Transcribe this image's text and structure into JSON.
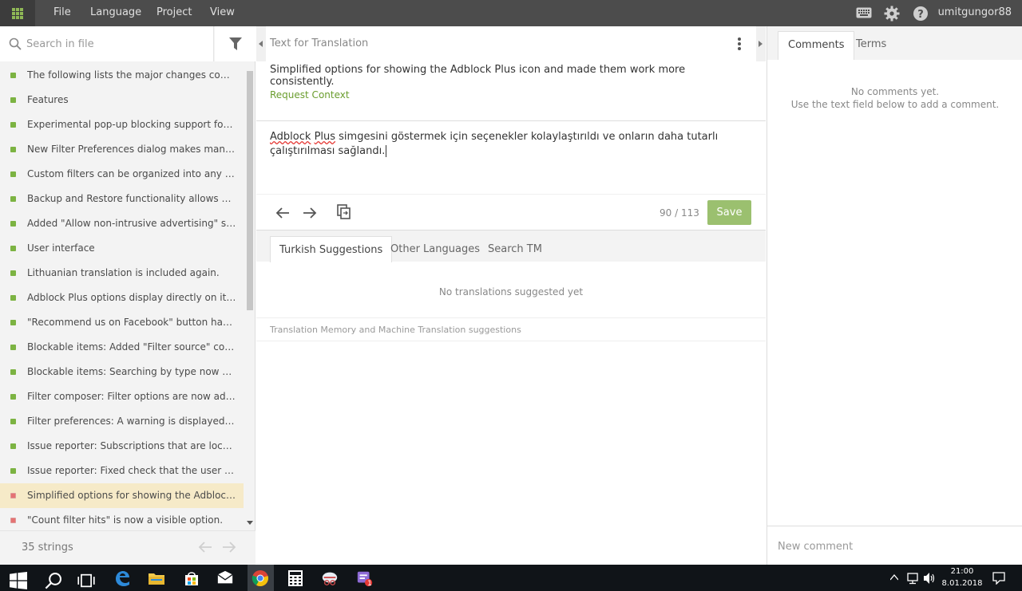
{
  "topbar": {
    "menu": [
      "File",
      "Language",
      "Project",
      "View"
    ],
    "username": "umitgungor88",
    "icons": [
      "keyboard-icon",
      "gear-icon",
      "help-icon"
    ]
  },
  "left": {
    "search_placeholder": "Search in file",
    "strings": [
      {
        "text": "The following lists the major changes compared to the previous version.",
        "status": "translated"
      },
      {
        "text": "Features",
        "status": "translated"
      },
      {
        "text": "Experimental pop-up blocking support for the browser.",
        "status": "translated"
      },
      {
        "text": "New Filter Preferences dialog makes managing filters easier.",
        "status": "translated"
      },
      {
        "text": "Custom filters can be organized into any number of groups.",
        "status": "translated"
      },
      {
        "text": "Backup and Restore functionality allows creating backups.",
        "status": "translated"
      },
      {
        "text": "Added \"Allow non-intrusive advertising\" setting.",
        "status": "translated"
      },
      {
        "text": "User interface",
        "status": "translated"
      },
      {
        "text": "Lithuanian translation is included again.",
        "status": "translated"
      },
      {
        "text": "Adblock Plus options display directly on its page.",
        "status": "translated"
      },
      {
        "text": "\"Recommend us on Facebook\" button has been added.",
        "status": "translated"
      },
      {
        "text": "Blockable items: Added \"Filter source\" column to the list.",
        "status": "translated"
      },
      {
        "text": "Blockable items: Searching by type now works correctly.",
        "status": "translated"
      },
      {
        "text": "Filter composer: Filter options are now added in the right order.",
        "status": "translated"
      },
      {
        "text": "Filter preferences: A warning is displayed for slow filters.",
        "status": "translated"
      },
      {
        "text": "Issue reporter: Subscriptions that are local files are ignored.",
        "status": "translated"
      },
      {
        "text": "Issue reporter: Fixed check that the user is subscribed.",
        "status": "translated"
      },
      {
        "text": "Simplified options for showing the Adblock Plus icon.",
        "status": "untranslated",
        "selected": true
      },
      {
        "text": "\"Count filter hits\" is now a visible option.",
        "status": "untranslated"
      }
    ],
    "count_label": "35 strings"
  },
  "center": {
    "source_header": "Text for Translation",
    "source_text": "Simplified options for showing the Adblock Plus icon and made them work more consistently.",
    "request_context": "Request Context",
    "translation_part1": "Adblock",
    "translation_part2": "Plus",
    "translation_rest": " simgesini göstermek için seçenekler kolaylaştırıldı ve onların daha tutarlı çalıştırılması sağlandı.",
    "char_count": "90 / 113",
    "save_label": "Save",
    "tabs": [
      "Turkish Suggestions",
      "Other Languages",
      "Search TM"
    ],
    "no_translations": "No translations suggested yet",
    "tm_note": "Translation Memory and Machine Translation suggestions"
  },
  "right": {
    "tabs": [
      "Comments",
      "Terms"
    ],
    "no_comments_line1": "No comments yet.",
    "no_comments_line2": "Use the text field below to add a comment.",
    "comment_placeholder": "New comment"
  },
  "taskbar": {
    "time": "21:00",
    "date": "8.01.2018",
    "notification_badge": "1"
  },
  "colors": {
    "accent_green": "#7cb342",
    "save_button": "#9bc06f",
    "link_green": "#6a9d2e",
    "untranslated_red": "#e57373",
    "selected_row": "#f6eac8"
  }
}
